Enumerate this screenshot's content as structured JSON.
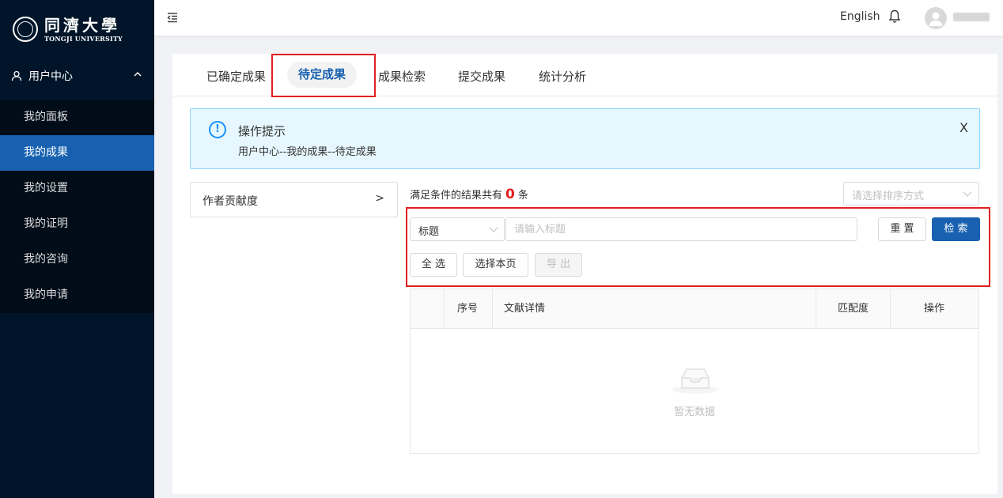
{
  "brand": {
    "name_cn": "同濟大學",
    "name_en": "TONGJI UNIVERSITY"
  },
  "sidebar": {
    "group_label": "用户中心",
    "items": [
      {
        "label": "我的面板"
      },
      {
        "label": "我的成果"
      },
      {
        "label": "我的设置"
      },
      {
        "label": "我的证明"
      },
      {
        "label": "我的咨询"
      },
      {
        "label": "我的申请"
      }
    ]
  },
  "header": {
    "language_label": "English"
  },
  "tabs": [
    {
      "label": "已确定成果"
    },
    {
      "label": "待定成果"
    },
    {
      "label": "成果检索"
    },
    {
      "label": "提交成果"
    },
    {
      "label": "统计分析"
    }
  ],
  "alert": {
    "icon_glyph": "!",
    "title": "操作提示",
    "breadcrumb": "用户中心--我的成果--待定成果",
    "close_glyph": "X"
  },
  "filter_panel": {
    "label": "作者贡献度",
    "arrow": ">"
  },
  "results": {
    "prefix": "满足条件的结果共有",
    "count": "0",
    "suffix": "条"
  },
  "sort": {
    "placeholder": "请选择排序方式"
  },
  "search": {
    "field_selected": "标题",
    "placeholder": "请输入标题",
    "reset_label": "重 置",
    "search_label": "检 索",
    "select_all_label": "全 选",
    "select_page_label": "选择本页",
    "export_label": "导 出"
  },
  "table": {
    "columns": [
      "序号",
      "文献详情",
      "匹配度",
      "操作"
    ],
    "empty_text": "暂无数据"
  },
  "colors": {
    "sidebar_bg": "#001529",
    "accent": "#1761b0",
    "highlight_box": "#e02020",
    "alert_bg": "#e6f7ff"
  }
}
